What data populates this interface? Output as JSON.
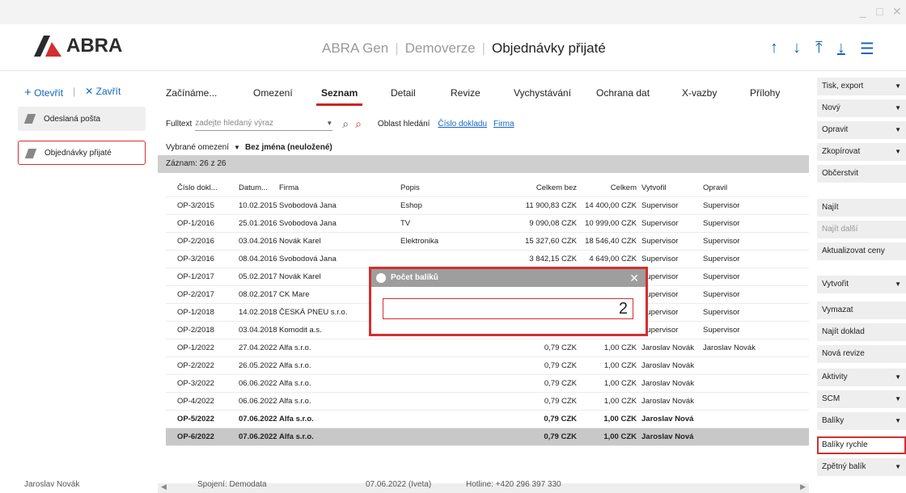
{
  "window": {
    "minimize": "_",
    "maximize": "□",
    "close": "✕"
  },
  "header": {
    "logo_text": "ABRA",
    "crumbs": [
      "ABRA Gen",
      "Demoverze"
    ],
    "title": "Objednávky přijaté",
    "icons": [
      "arrow-up-icon",
      "arrow-down-icon",
      "arrow-top-icon",
      "arrow-bottom-icon",
      "menu-icon"
    ]
  },
  "sidebar": {
    "open_label": "Otevřít",
    "close_label": "Zavřít",
    "items": [
      {
        "label": "Odeslaná pošta"
      },
      {
        "label": "Objednávky přijaté"
      }
    ]
  },
  "tabs": [
    "Začínáme...",
    "Omezení",
    "Seznam",
    "Detail",
    "Revize",
    "Vychystávání",
    "Ochrana dat",
    "X-vazby",
    "Přílohy"
  ],
  "search": {
    "label": "Fulltext",
    "placeholder": "zadejte hledaný výraz",
    "area_label": "Oblast hledání",
    "links": [
      "Číslo dokladu",
      "Firma"
    ]
  },
  "filter": {
    "label": "Vybrané omezení",
    "value": "Bez jména (neuložené)"
  },
  "record_count": "Záznam: 26 z 26",
  "grid": {
    "columns": [
      "Číslo dokl...",
      "Datum...",
      "Firma",
      "Popis",
      "Celkem bez",
      "Celkem",
      "Vytvořil",
      "Opravil"
    ],
    "rows": [
      [
        "OP-3/2015",
        "10.02.2015",
        "Svobodová Jana",
        "Eshop",
        "11 900,83 CZK",
        "14 400,00 CZK",
        "Supervisor",
        "Supervisor"
      ],
      [
        "OP-1/2016",
        "25.01.2016",
        "Svobodová Jana",
        "TV",
        "9 090,08 CZK",
        "10 999,00 CZK",
        "Supervisor",
        "Supervisor"
      ],
      [
        "OP-2/2016",
        "03.04.2016",
        "Novák Karel",
        "Elektronika",
        "15 327,60 CZK",
        "18 546,40 CZK",
        "Supervisor",
        "Supervisor"
      ],
      [
        "OP-3/2016",
        "08.04.2016",
        "Svobodová Jana",
        "",
        "3 842,15 CZK",
        "4 649,00 CZK",
        "Supervisor",
        "Supervisor"
      ],
      [
        "OP-1/2017",
        "05.02.2017",
        "Novák Karel",
        "",
        "",
        "",
        "Supervisor",
        "Supervisor"
      ],
      [
        "OP-2/2017",
        "08.02.2017",
        "CK Mare",
        "",
        "",
        "",
        "Supervisor",
        "Supervisor"
      ],
      [
        "OP-1/2018",
        "14.02.2018",
        "ČESKÁ PNEU s.r.o.",
        "",
        "",
        "",
        "Supervisor",
        "Supervisor"
      ],
      [
        "OP-2/2018",
        "03.04.2018",
        "Komodit a.s.",
        "",
        "",
        "",
        "Supervisor",
        "Supervisor"
      ],
      [
        "OP-1/2022",
        "27.04.2022",
        "Alfa s.r.o.",
        "",
        "0,79 CZK",
        "1,00 CZK",
        "Jaroslav Novák",
        "Jaroslav Novák"
      ],
      [
        "OP-2/2022",
        "26.05.2022",
        "Alfa s.r.o.",
        "",
        "0,79 CZK",
        "1,00 CZK",
        "Jaroslav Novák",
        ""
      ],
      [
        "OP-3/2022",
        "06.06.2022",
        "Alfa s.r.o.",
        "",
        "0,79 CZK",
        "1,00 CZK",
        "Jaroslav Novák",
        ""
      ],
      [
        "OP-4/2022",
        "06.06.2022",
        "Alfa s.r.o.",
        "",
        "0,79 CZK",
        "1,00 CZK",
        "Jaroslav Novák",
        ""
      ],
      [
        "OP-5/2022",
        "07.06.2022",
        "Alfa s.r.o.",
        "",
        "0,79 CZK",
        "1,00 CZK",
        "Jaroslav Nová",
        ""
      ],
      [
        "OP-6/2022",
        "07.06.2022",
        "Alfa s.r.o.",
        "",
        "0,79 CZK",
        "1,00 CZK",
        "Jaroslav Nová",
        ""
      ]
    ]
  },
  "dialog": {
    "title": "Počet balíků",
    "value": "2",
    "close": "✕"
  },
  "actions": [
    {
      "label": "Tisk, export",
      "dropdown": true
    },
    {
      "label": "Nový",
      "dropdown": true
    },
    {
      "label": "Opravit",
      "dropdown": true
    },
    {
      "label": "Zkopírovat",
      "dropdown": true
    },
    {
      "label": "Občerstvit",
      "dropdown": false
    },
    {
      "label": "Najít",
      "dropdown": false
    },
    {
      "label": "Najít další",
      "dropdown": false,
      "disabled": true
    },
    {
      "label": "Aktualizovat ceny",
      "dropdown": false
    },
    {
      "label": "Vytvořit",
      "dropdown": true
    },
    {
      "label": "Vymazat",
      "dropdown": false
    },
    {
      "label": "Najít doklad",
      "dropdown": false
    },
    {
      "label": "Nová revize",
      "dropdown": false
    },
    {
      "label": "Aktivity",
      "dropdown": true
    },
    {
      "label": "SCM",
      "dropdown": true
    },
    {
      "label": "Balíky",
      "dropdown": true
    },
    {
      "label": "Balíky rychle",
      "dropdown": false,
      "highlighted": true
    },
    {
      "label": "Zpětný balík",
      "dropdown": true
    }
  ],
  "status": {
    "user": "Jaroslav Novák",
    "connection": "Spojení: Demodata",
    "date": "07.06.2022 (Iveta)",
    "hotline": "Hotline: +420 296 397 330"
  },
  "colors": {
    "accent": "#1565c0",
    "highlight": "#d32f2f",
    "brand": "#2b2b2b"
  }
}
